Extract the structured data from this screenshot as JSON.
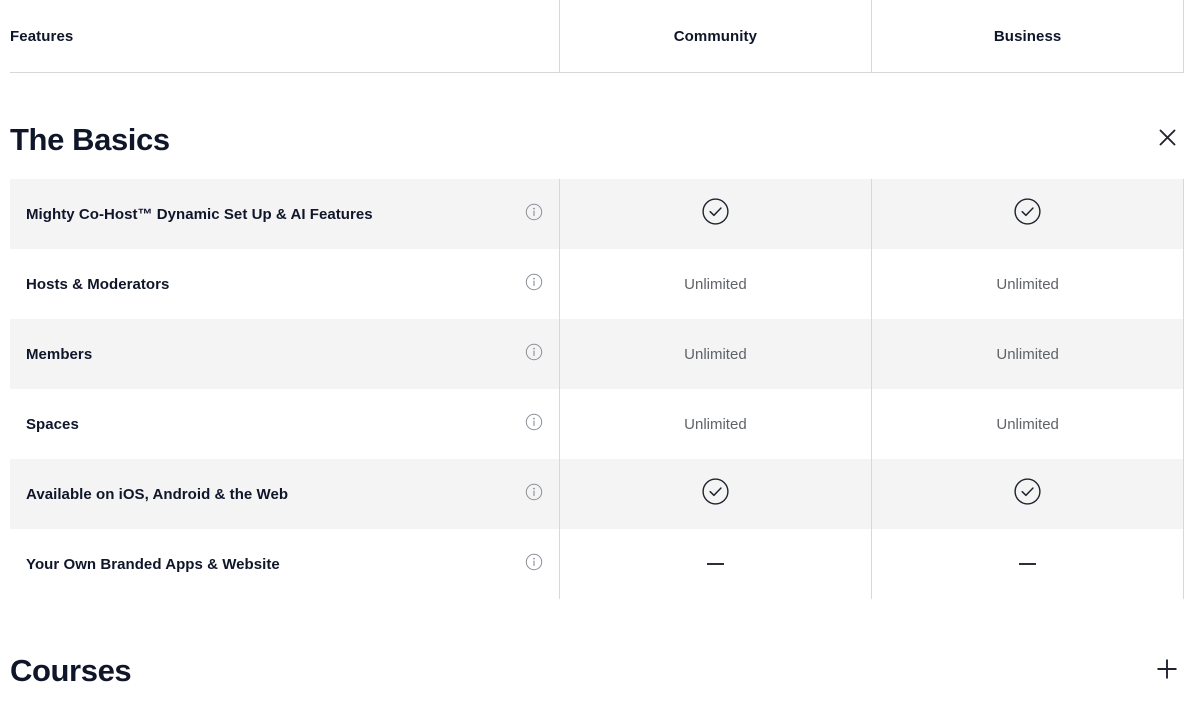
{
  "table_header": {
    "features_label": "Features",
    "plans": [
      "Community",
      "Business"
    ]
  },
  "sections": [
    {
      "title": "The Basics",
      "expanded": true,
      "toggle_icon": "close-icon",
      "rows": [
        {
          "name": "Mighty Co-Host™ Dynamic Set Up & AI Features",
          "info_icon": "info-icon",
          "community": "check",
          "business": "check"
        },
        {
          "name": "Hosts & Moderators",
          "info_icon": "info-icon",
          "community": "Unlimited",
          "business": "Unlimited"
        },
        {
          "name": "Members",
          "info_icon": "info-icon",
          "community": "Unlimited",
          "business": "Unlimited"
        },
        {
          "name": "Spaces",
          "info_icon": "info-icon",
          "community": "Unlimited",
          "business": "Unlimited"
        },
        {
          "name": "Available on iOS, Android & the Web",
          "info_icon": "info-icon",
          "community": "check",
          "business": "check"
        },
        {
          "name": "Your Own Branded Apps & Website",
          "info_icon": "info-icon",
          "community": "dash",
          "business": "dash"
        }
      ]
    },
    {
      "title": "Courses",
      "expanded": false,
      "toggle_icon": "plus-icon",
      "rows": []
    }
  ],
  "colors": {
    "text_primary": "#10162a",
    "text_muted": "#5f6368",
    "row_alt_bg": "#f4f4f4",
    "border": "#d8d8d8",
    "icon_dark": "#1f2430",
    "icon_gray": "#8a8f99"
  }
}
